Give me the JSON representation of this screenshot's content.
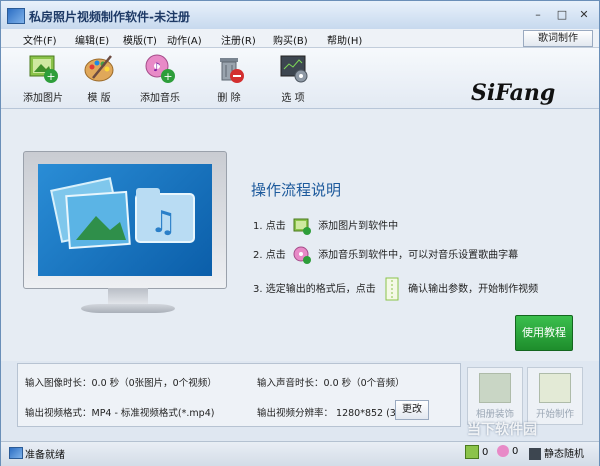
{
  "window": {
    "title": "私房照片视频制作软件-未注册",
    "controls": {
      "minimize": "–",
      "maximize": "□",
      "close": "✕"
    }
  },
  "menu": [
    "文件(F)",
    "编辑(E)",
    "模版(T)",
    "动作(A)",
    "注册(R)",
    "购买(B)",
    "帮助(H)"
  ],
  "lyric_button": "歌词制作",
  "toolbar": [
    {
      "label": "添加图片",
      "icon": "add-image-icon"
    },
    {
      "label": "模 版",
      "icon": "palette-icon"
    },
    {
      "label": "添加音乐",
      "icon": "add-music-icon"
    },
    {
      "label": "删 除",
      "icon": "delete-icon"
    },
    {
      "label": "选 项",
      "icon": "options-icon"
    }
  ],
  "logo": "SiFang",
  "instructions": {
    "title": "操作流程说明",
    "step1_prefix": "1. 点击",
    "step1_suffix": "添加图片到软件中",
    "step2_prefix": "2. 点击",
    "step2_suffix": "添加音乐到软件中，可以对音乐设置歌曲字幕",
    "step3_prefix": "3. 选定输出的格式后，点击",
    "step3_suffix": "确认输出参数，开始制作视频"
  },
  "tutorial_button": "使用教程",
  "info": {
    "image_duration": "输入图像时长：0.0 秒（0张图片，0个视频）",
    "audio_duration": "输入声音时长：0.0 秒（0个音频）",
    "video_format": "输出视频格式：MP4 - 标准视频格式(*.mp4)",
    "resolution": "输出视频分辨率：  1280*852 (3:2)",
    "change_button": "更改"
  },
  "side_buttons": {
    "album": "相册装饰",
    "start": "开始制作"
  },
  "status": {
    "text": "准备就绪",
    "image_count": "0",
    "music_count": "0",
    "mode": "静态随机"
  },
  "watermark": "当下软件园",
  "colors": {
    "accent": "#1d5a9c",
    "tutorial_green": "#2ea83f"
  }
}
